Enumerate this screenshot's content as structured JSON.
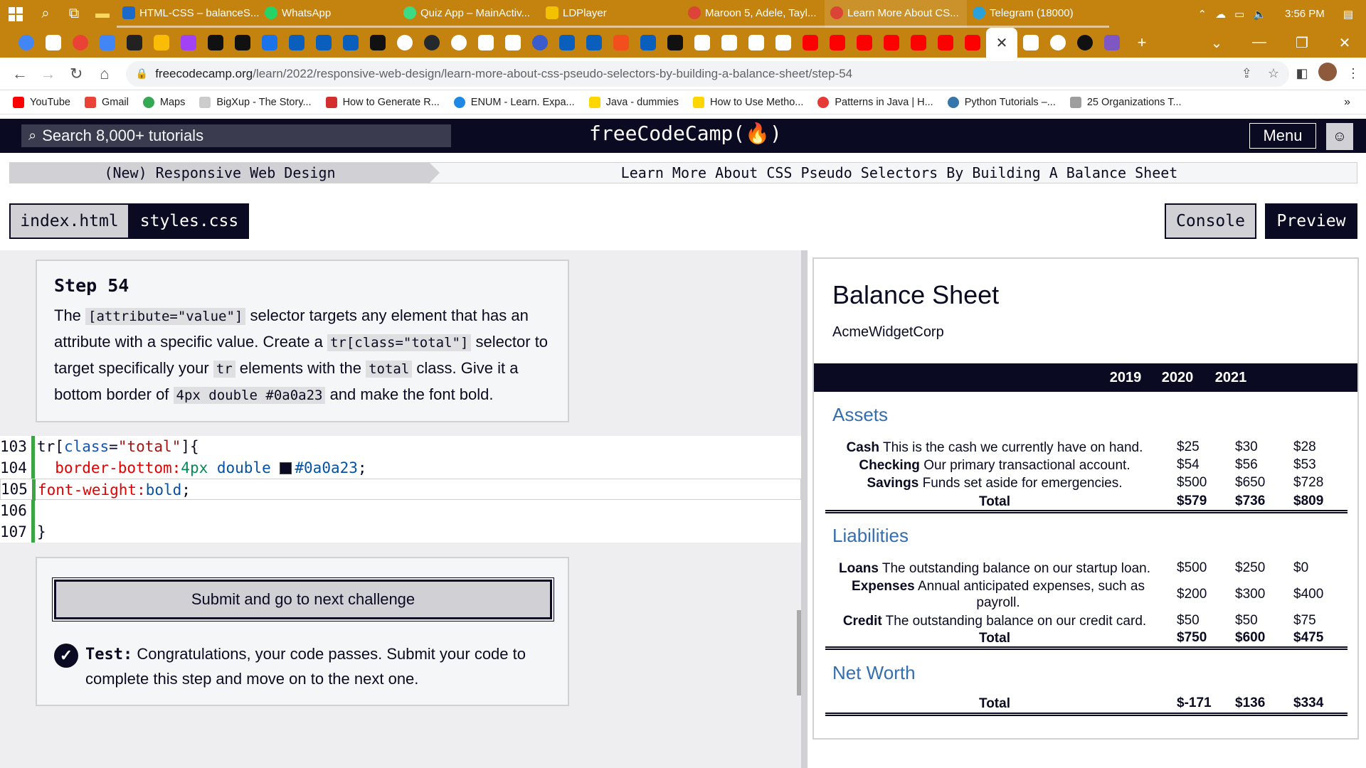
{
  "taskbar": {
    "apps": [
      "HTML-CSS – balanceS...",
      "WhatsApp",
      "Quiz App – MainActiv...",
      "LDPlayer",
      "Maroon 5, Adele, Tayl...",
      "Learn More About CS...",
      "Telegram (18000)"
    ],
    "time": "3:56 PM"
  },
  "browser": {
    "url_host": "freecodecamp.org",
    "url_path": "/learn/2022/responsive-web-design/learn-more-about-css-pseudo-selectors-by-building-a-balance-sheet/step-54",
    "bookmarks": [
      "YouTube",
      "Gmail",
      "Maps",
      "BigXup - The Story...",
      "How to Generate R...",
      "ENUM - Learn. Expa...",
      "Java - dummies",
      "How to Use Metho...",
      "Patterns in Java | H...",
      "Python Tutorials –...",
      "25 Organizations T..."
    ]
  },
  "fcc": {
    "search_placeholder": "Search 8,000+ tutorials",
    "logo": "freeCodeCamp(🔥)",
    "menu": "Menu"
  },
  "breadcrumb": {
    "course": "(New) Responsive Web Design",
    "project": "Learn More About CSS Pseudo Selectors By Building A Balance Sheet"
  },
  "editor_tabs": {
    "index": "index.html",
    "styles": "styles.css",
    "console": "Console",
    "preview": "Preview"
  },
  "step": {
    "title": "Step 54",
    "t1": "The ",
    "c1": "[attribute=\"value\"]",
    "t2": " selector targets any element that has an attribute with a specific value. Create a ",
    "c2": "tr[class=\"total\"]",
    "t3": " selector to target specifically your ",
    "c3": "tr",
    "t4": " elements with the ",
    "c4": "total",
    "t5": " class. Give it a bottom border of ",
    "c5": "4px double #0a0a23",
    "t6": " and make the font bold."
  },
  "code": {
    "line_numbers": [
      "103",
      "104",
      "105",
      "106",
      "107"
    ],
    "l1_tag": "tr",
    "l1_open": "[",
    "l1_attr": "class",
    "l1_eq": "=",
    "l1_str": "\"total\"",
    "l1_close": "]{",
    "l2_prop": "  border-bottom:",
    "l2_num": "4px",
    "l2_kw": " double ",
    "l2_color": "#0a0a23",
    "l2_end": ";",
    "l3_prop": "font-weight:",
    "l3_val": "bold",
    "l3_end": ";",
    "l5": "}"
  },
  "test": {
    "submit": "Submit and go to next challenge",
    "label": "Test:",
    "message": " Congratulations, your code passes. Submit your code to complete this step and move on to the next one."
  },
  "preview": {
    "title": "Balance Sheet",
    "company": "AcmeWidgetCorp",
    "years": [
      "2019",
      "2020",
      "2021"
    ],
    "assets": {
      "heading": "Assets",
      "rows": [
        {
          "name": "Cash",
          "desc": " This is the cash we currently have on hand.",
          "v": [
            "$25",
            "$30",
            "$28"
          ]
        },
        {
          "name": "Checking",
          "desc": " Our primary transactional account.",
          "v": [
            "$54",
            "$56",
            "$53"
          ]
        },
        {
          "name": "Savings",
          "desc": " Funds set aside for emergencies.",
          "v": [
            "$500",
            "$650",
            "$728"
          ]
        }
      ],
      "total": {
        "label": "Total",
        "v": [
          "$579",
          "$736",
          "$809"
        ]
      }
    },
    "liabilities": {
      "heading": "Liabilities",
      "rows": [
        {
          "name": "Loans",
          "desc": " The outstanding balance on our startup loan.",
          "v": [
            "$500",
            "$250",
            "$0"
          ]
        },
        {
          "name": "Expenses",
          "desc": " Annual anticipated expenses, such as payroll.",
          "v": [
            "$200",
            "$300",
            "$400"
          ]
        },
        {
          "name": "Credit",
          "desc": " The outstanding balance on our credit card.",
          "v": [
            "$50",
            "$50",
            "$75"
          ]
        }
      ],
      "total": {
        "label": "Total",
        "v": [
          "$750",
          "$600",
          "$475"
        ]
      }
    },
    "net_worth": {
      "heading": "Net Worth",
      "total": {
        "label": "Total",
        "v": [
          "$-171",
          "$136",
          "$334"
        ]
      }
    }
  }
}
